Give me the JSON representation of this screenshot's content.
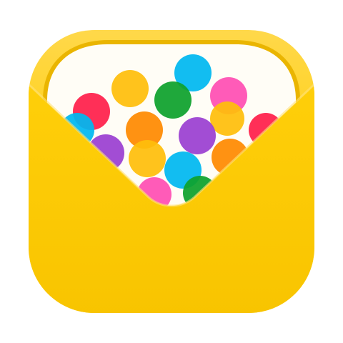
{
  "app_icon": {
    "icon": "envelope-confetti-icon",
    "colors": {
      "envelope_top": "#ffd84a",
      "envelope_mid": "#ffcf0a",
      "envelope_bottom": "#f8c400",
      "inner_rim": "#eab500",
      "paper": "#fffdf6",
      "dot_colors": [
        "#00b8f0",
        "#ffbe0b",
        "#ff4fb3",
        "#0ea12c",
        "#ff1f4a",
        "#ff8a00",
        "#9b3fd1"
      ]
    }
  }
}
